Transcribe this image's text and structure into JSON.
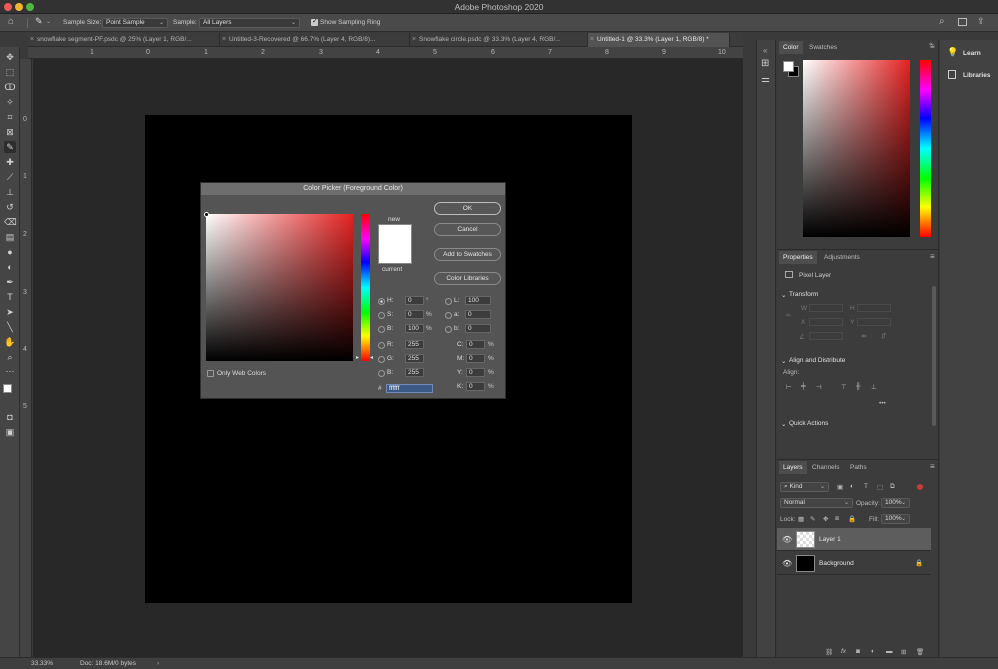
{
  "app": {
    "title": "Adobe Photoshop 2020"
  },
  "options_bar": {
    "sample_size_label": "Sample Size:",
    "sample_size_value": "Point Sample",
    "sample_label": "Sample:",
    "sample_value": "All Layers",
    "show_ring_label": "Show Sampling Ring",
    "show_ring_checked": true
  },
  "doc_tabs": [
    {
      "label": "snowflake segment-PF.psdc @ 25% (Layer 1, RGB/..."
    },
    {
      "label": "Untitled-3-Recovered @ 66.7% (Layer 4, RGB/8)..."
    },
    {
      "label": "Snowflake circle.psdc @ 33.3% (Layer 4, RGB/..."
    },
    {
      "label": "Untitled-1 @ 33.3% (Layer 1, RGB/8) *",
      "active": true
    }
  ],
  "ruler_h": [
    "1",
    "0",
    "1",
    "2",
    "3",
    "4",
    "5",
    "6",
    "7",
    "8",
    "9",
    "10"
  ],
  "ruler_v": [
    "0",
    "1",
    "2",
    "3",
    "4",
    "5"
  ],
  "status": {
    "zoom": "33.33%",
    "doc": "Doc: 18.6M/0 bytes"
  },
  "dialog": {
    "title": "Color Picker (Foreground Color)",
    "new_label": "new",
    "current_label": "current",
    "ok": "OK",
    "cancel": "Cancel",
    "add_swatches": "Add to Swatches",
    "color_libraries": "Color Libraries",
    "only_web": "Only Web Colors",
    "hsb": {
      "H": "0",
      "S": "0",
      "B": "100",
      "h_unit": "°",
      "s_unit": "%",
      "b_unit": "%"
    },
    "rgb": {
      "R": "255",
      "G": "255",
      "B": "255"
    },
    "lab": {
      "L": "100",
      "a": "0",
      "b": "0"
    },
    "cmyk": {
      "C": "0",
      "M": "0",
      "Y": "0",
      "K": "0",
      "unit": "%"
    },
    "hex_label": "#",
    "hex": "ffffff",
    "labels": {
      "H": "H:",
      "S": "S:",
      "B": "B:",
      "R": "R:",
      "G": "G:",
      "Bl": "B:",
      "L": "L:",
      "a": "a:",
      "b": "b:",
      "C": "C:",
      "M": "M:",
      "Y": "Y:",
      "K": "K:"
    }
  },
  "panels": {
    "color_tabs": [
      "Color",
      "Swatches"
    ],
    "properties_tabs": [
      "Properties",
      "Adjustments"
    ],
    "pixel_layer": "Pixel Layer",
    "transform": "Transform",
    "align": "Align and Distribute",
    "align_label": "Align:",
    "quick_actions": "Quick Actions",
    "transform_fields": {
      "W": "W",
      "H": "H",
      "X": "X",
      "Y": "Y"
    },
    "layers_tabs": [
      "Layers",
      "Channels",
      "Paths"
    ],
    "kind": "Kind",
    "blend_mode": "Normal",
    "opacity_label": "Opacity:",
    "opacity": "100%",
    "lock_label": "Lock:",
    "fill_label": "Fill:",
    "fill": "100%",
    "layers": [
      {
        "name": "Layer 1",
        "selected": true
      },
      {
        "name": "Background",
        "locked": true
      }
    ]
  },
  "far_right": {
    "learn": "Learn",
    "libraries": "Libraries"
  },
  "colors": {
    "accent": "#4a8fe7",
    "canvas": "#000000"
  }
}
